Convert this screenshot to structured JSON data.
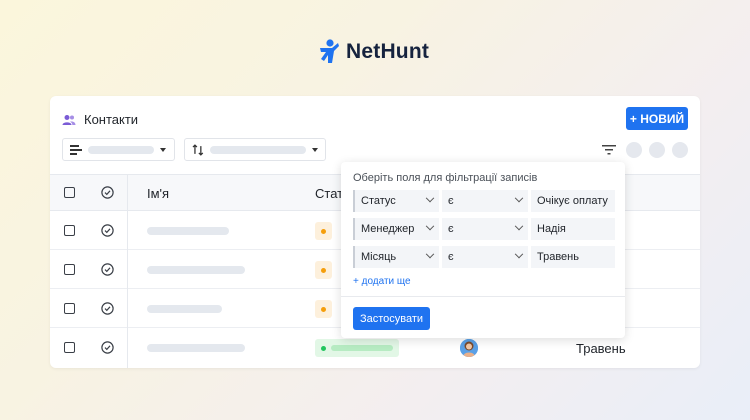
{
  "brand": {
    "name": "NetHunt",
    "accent": "#1f73f0"
  },
  "header": {
    "title": "Контакти",
    "icon": "contacts-icon",
    "new_button": "+ НОВИЙ"
  },
  "toolbar": {
    "group_icon": "group-by-icon",
    "sort_icon": "sort-icon",
    "filter_icon": "filter-icon"
  },
  "table": {
    "columns": [
      "Ім'я",
      "Стат"
    ],
    "rows": [
      {
        "status_color": "#f59e0b",
        "month": ""
      },
      {
        "status_color": "#f59e0b",
        "month": ""
      },
      {
        "status_color": "#f59e0b",
        "month": ""
      },
      {
        "status_color": "#22c55e",
        "month": "Травень"
      }
    ]
  },
  "filter_popover": {
    "title": "Оберіть поля для фільтрації записів",
    "filters": [
      {
        "field": "Статус",
        "op": "є",
        "value": "Очікує оплату"
      },
      {
        "field": "Менеджер",
        "op": "є",
        "value": "Надія"
      },
      {
        "field": "Місяць",
        "op": "є",
        "value": "Травень"
      }
    ],
    "add_more": "+ додати ще",
    "apply": "Застосувати"
  }
}
